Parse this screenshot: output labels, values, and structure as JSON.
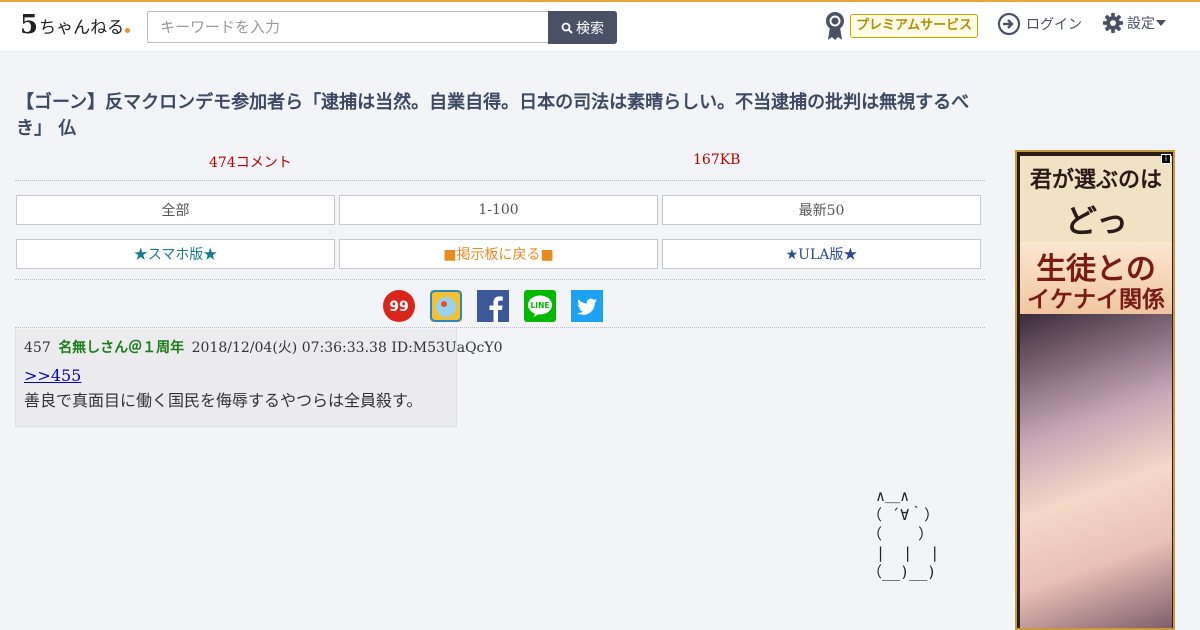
{
  "header": {
    "logo_text": "5ちゃんねる",
    "search_placeholder": "キーワードを入力",
    "search_button": "検索",
    "premium_label": "プレミアムサービス",
    "login_label": "ログイン",
    "settings_label": "設定"
  },
  "thread": {
    "title": "【ゴーン】反マクロンデモ参加者ら「逮捕は当然。自業自得。日本の司法は素晴らしい。不当逮捕の批判は無視するべき」 仏",
    "comments": "474コメント",
    "size": "167KB"
  },
  "nav": {
    "all": "全部",
    "range": "1-100",
    "latest": "最新50",
    "smartphone": "★スマホ版★",
    "back_to_board": "■掲示板に戻る■",
    "ula": "★ULA版★"
  },
  "post": {
    "number": "457",
    "name": "名無しさん＠１周年",
    "date": "2018/12/04(火) 07:36:33.38",
    "id": "ID:M53UaQcY0",
    "anchor": ">>455",
    "body": "善良で真面目に働く国民を侮辱するやつらは全員殺す。"
  },
  "ascii_art": "  ∧＿∧\n （ ´∀｀）\n （    ）\n  |  |  |\n （__)__)",
  "ad": {
    "line1": "君が選ぶのは",
    "line2": "どっち？？",
    "line3": "生徒との",
    "line4": "イケナイ関係",
    "info": "i"
  },
  "colors": {
    "accent": "#e8a33a",
    "title": "#3d4a63",
    "meta_red": "#b00000",
    "smartphone_link": "#1a7a8a",
    "board_link": "#e88a20",
    "ula_link": "#2a4a9a",
    "poster_name": "#1a7d1a"
  }
}
